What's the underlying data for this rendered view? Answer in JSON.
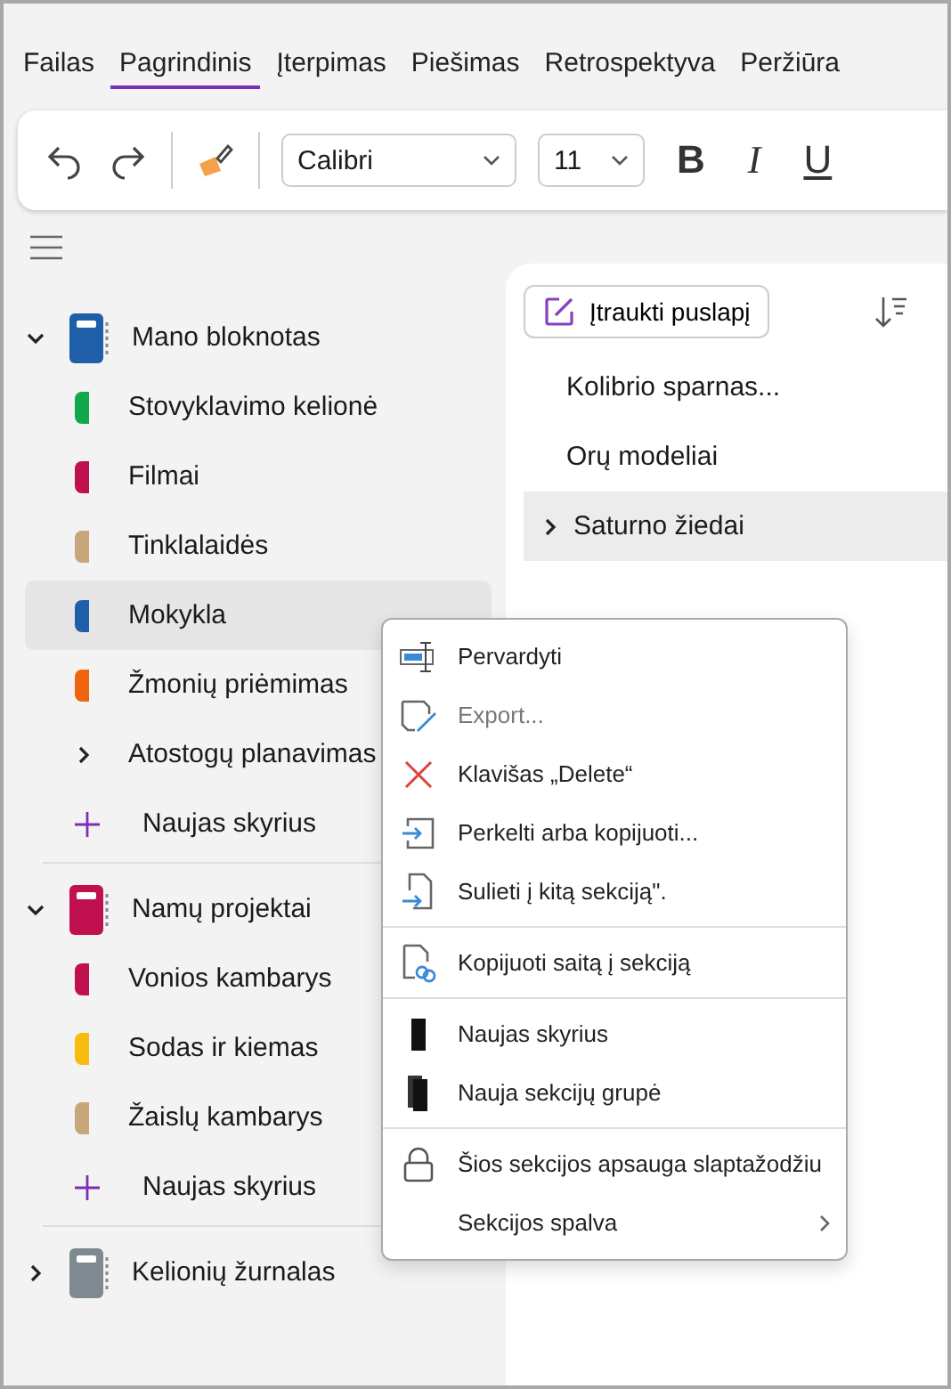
{
  "ribbon_tabs": [
    {
      "label": "Failas",
      "selected": false
    },
    {
      "label": "Pagrindinis",
      "selected": true
    },
    {
      "label": "Įterpimas",
      "selected": false
    },
    {
      "label": "Piešimas",
      "selected": false
    },
    {
      "label": "Retrospektyva",
      "selected": false
    },
    {
      "label": "Peržiūra",
      "selected": false
    }
  ],
  "toolbar": {
    "font": "Calibri",
    "size": "11",
    "bold": "B",
    "italic": "I",
    "underline": "U"
  },
  "notebooks": [
    {
      "title": "Mano bloknotas",
      "color": "#1f5fa8",
      "expanded": true,
      "add_label": "Naujas skyrius",
      "sections": [
        {
          "label": "Stovyklavimo kelionė",
          "color": "#10a84a",
          "selected": false,
          "kind": "section"
        },
        {
          "label": "Filmai",
          "color": "#c0104f",
          "selected": false,
          "kind": "section"
        },
        {
          "label": "Tinklalaidės",
          "color": "#c8a67c",
          "selected": false,
          "kind": "section"
        },
        {
          "label": "Mokykla",
          "color": "#1f5fa8",
          "selected": true,
          "kind": "section"
        },
        {
          "label": "Žmonių priėmimas",
          "color": "#f0640f",
          "selected": false,
          "kind": "section"
        },
        {
          "label": "Atostogų planavimas",
          "selected": false,
          "kind": "group"
        }
      ]
    },
    {
      "title": "Namų projektai",
      "color": "#c0104f",
      "expanded": true,
      "add_label": "Naujas skyrius",
      "sections": [
        {
          "label": "Vonios kambarys",
          "color": "#c0104f",
          "selected": false,
          "kind": "section"
        },
        {
          "label": "Sodas ir kiemas",
          "color": "#f8bc10",
          "selected": false,
          "kind": "section"
        },
        {
          "label": "Žaislų kambarys",
          "color": "#c8a67c",
          "selected": false,
          "kind": "section"
        }
      ]
    },
    {
      "title": "Kelionių žurnalas",
      "color": "#7f8a90",
      "expanded": false
    }
  ],
  "pages": {
    "add_label": "Įtraukti puslapį",
    "items": [
      {
        "label": "Kolibrio sparnas...",
        "selected": false,
        "has_subpages": false
      },
      {
        "label": "Orų modeliai",
        "selected": false,
        "has_subpages": false
      },
      {
        "label": "Saturno žiedai",
        "selected": true,
        "has_subpages": true
      }
    ]
  },
  "context_menu": [
    {
      "label": "Pervardyti",
      "kind": "rename",
      "disabled": false,
      "separator_before": false,
      "submenu": false
    },
    {
      "label": "Export...",
      "kind": "export",
      "disabled": true,
      "separator_before": false,
      "submenu": false
    },
    {
      "label": "Klavišas „Delete“",
      "kind": "delete",
      "disabled": false,
      "separator_before": false,
      "submenu": false
    },
    {
      "label": "Perkelti arba kopijuoti...",
      "kind": "move",
      "disabled": false,
      "separator_before": false,
      "submenu": false
    },
    {
      "label": "Sulieti į kitą sekciją\".",
      "kind": "merge",
      "disabled": false,
      "separator_before": false,
      "submenu": false
    },
    {
      "label": "Kopijuoti saitą į sekciją",
      "kind": "link",
      "disabled": false,
      "separator_before": true,
      "submenu": false
    },
    {
      "label": "Naujas skyrius",
      "kind": "new-section",
      "disabled": false,
      "separator_before": true,
      "submenu": false
    },
    {
      "label": "Nauja sekcijų grupė",
      "kind": "new-group",
      "disabled": false,
      "separator_before": false,
      "submenu": false
    },
    {
      "label": "Šios sekcijos apsauga slaptažodžiu",
      "kind": "lock",
      "disabled": false,
      "separator_before": true,
      "submenu": false
    },
    {
      "label": "Sekcijos spalva",
      "kind": "color",
      "disabled": false,
      "separator_before": false,
      "submenu": true
    }
  ]
}
